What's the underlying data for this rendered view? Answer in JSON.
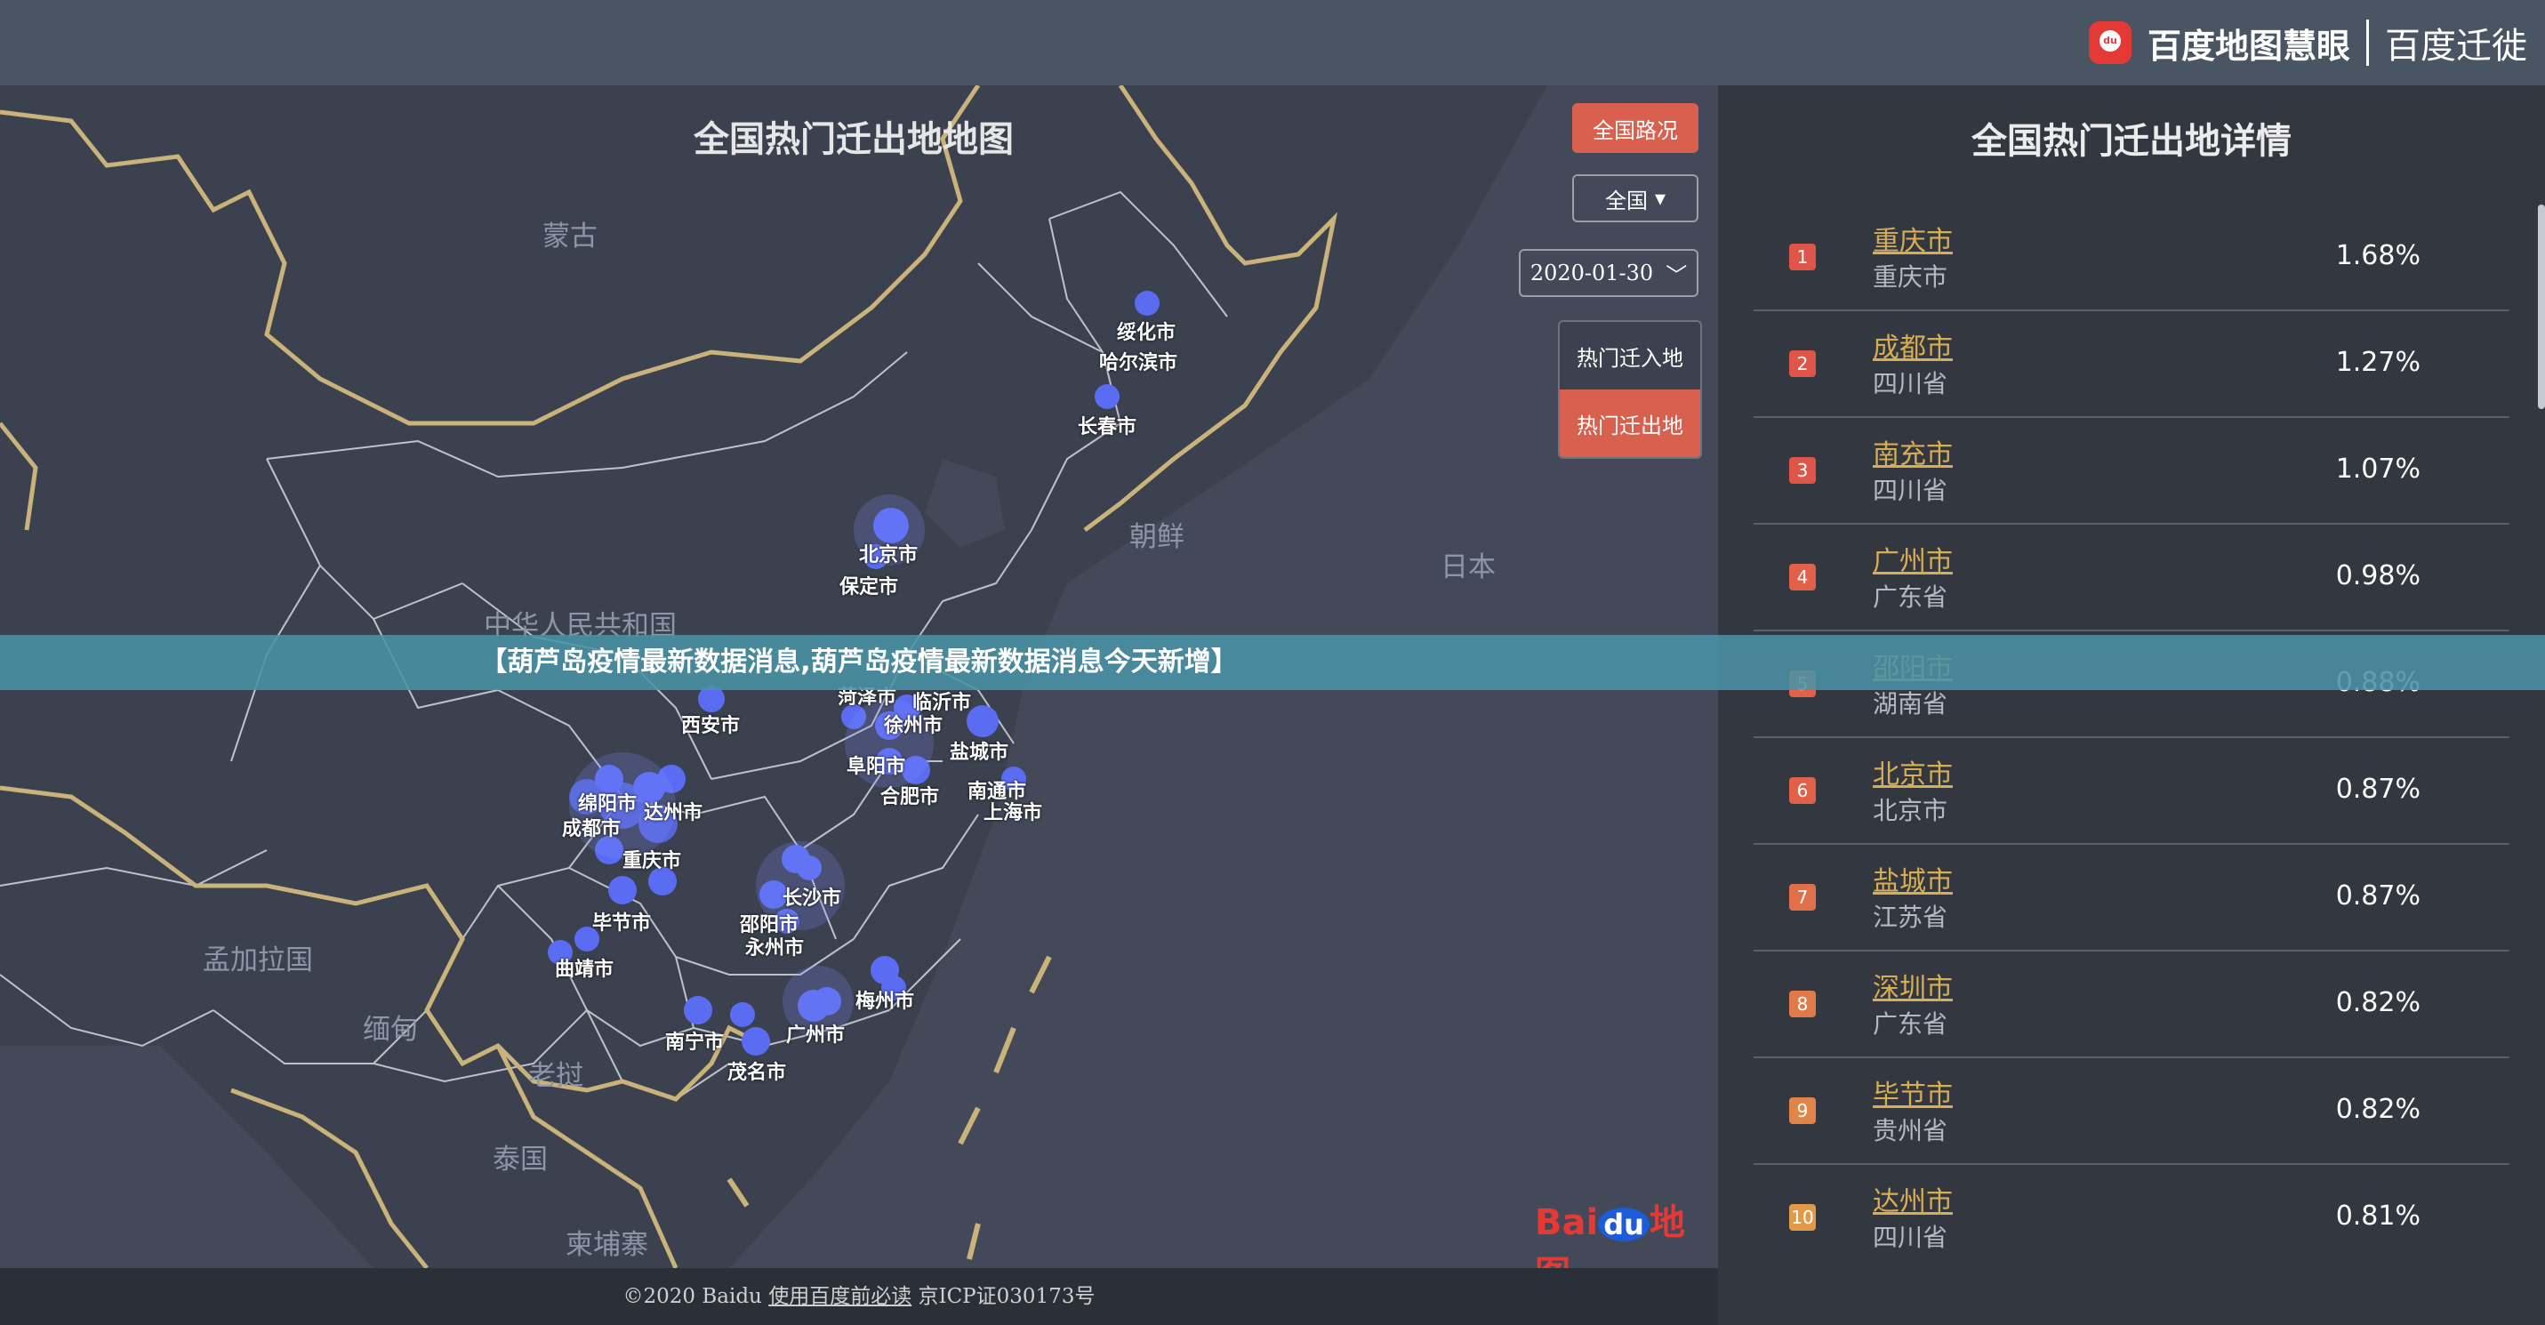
{
  "brand": {
    "logo_glyph": "du",
    "name": "百度地图慧眼",
    "product": "百度迁徙"
  },
  "map": {
    "title": "全国热门迁出地地图",
    "country_labels": [
      "蒙古",
      "朝鲜",
      "日本",
      "中华人民共和国",
      "孟加拉国",
      "缅甸",
      "老挝",
      "泰国",
      "柬埔寨"
    ],
    "city_labels": [
      "绥化市",
      "哈尔滨市",
      "长春市",
      "北京市",
      "保定市",
      "西安市",
      "菏泽市",
      "临沂市",
      "徐州市",
      "阜阳市",
      "盐城市",
      "合肥市",
      "南通市",
      "上海市",
      "绵阳市",
      "达州市",
      "成都市",
      "重庆市",
      "长沙市",
      "邵阳市",
      "永州市",
      "毕节市",
      "曲靖市",
      "南宁市",
      "广州市",
      "梅州市",
      "茂名市"
    ],
    "watermark": {
      "left": "Bai",
      "middle": "du",
      "right": "地图"
    }
  },
  "controls": {
    "national_roads": "全国路况",
    "region": "全国",
    "region_caret": "▾",
    "date": "2020-01-30",
    "date_caret": "﹀",
    "hot_in": "热门迁入地",
    "hot_out": "热门迁出地"
  },
  "panel": {
    "title": "全国热门迁出地详情",
    "rows": [
      {
        "rank": "1",
        "city": "重庆市",
        "province": "重庆市",
        "pct": "1.68%",
        "color": "#e0554a"
      },
      {
        "rank": "2",
        "city": "成都市",
        "province": "四川省",
        "pct": "1.27%",
        "color": "#e0554a"
      },
      {
        "rank": "3",
        "city": "南充市",
        "province": "四川省",
        "pct": "1.07%",
        "color": "#e0554a"
      },
      {
        "rank": "4",
        "city": "广州市",
        "province": "广东省",
        "pct": "0.98%",
        "color": "#e0604a"
      },
      {
        "rank": "5",
        "city": "邵阳市",
        "province": "湖南省",
        "pct": "0.88%",
        "color": "#e0604a"
      },
      {
        "rank": "6",
        "city": "北京市",
        "province": "北京市",
        "pct": "0.87%",
        "color": "#e0604a"
      },
      {
        "rank": "7",
        "city": "盐城市",
        "province": "江苏省",
        "pct": "0.87%",
        "color": "#e0704a"
      },
      {
        "rank": "8",
        "city": "深圳市",
        "province": "广东省",
        "pct": "0.82%",
        "color": "#e07a4a"
      },
      {
        "rank": "9",
        "city": "毕节市",
        "province": "贵州省",
        "pct": "0.82%",
        "color": "#e0854a"
      },
      {
        "rank": "10",
        "city": "达州市",
        "province": "四川省",
        "pct": "0.81%",
        "color": "#e09a4a"
      }
    ]
  },
  "footer": {
    "copyright": "©2020 Baidu",
    "terms_link": "使用百度前必读",
    "icp": "京ICP证030173号"
  },
  "banner": {
    "text": "【葫芦岛疫情最新数据消息,葫芦岛疫情最新数据消息今天新增】"
  }
}
